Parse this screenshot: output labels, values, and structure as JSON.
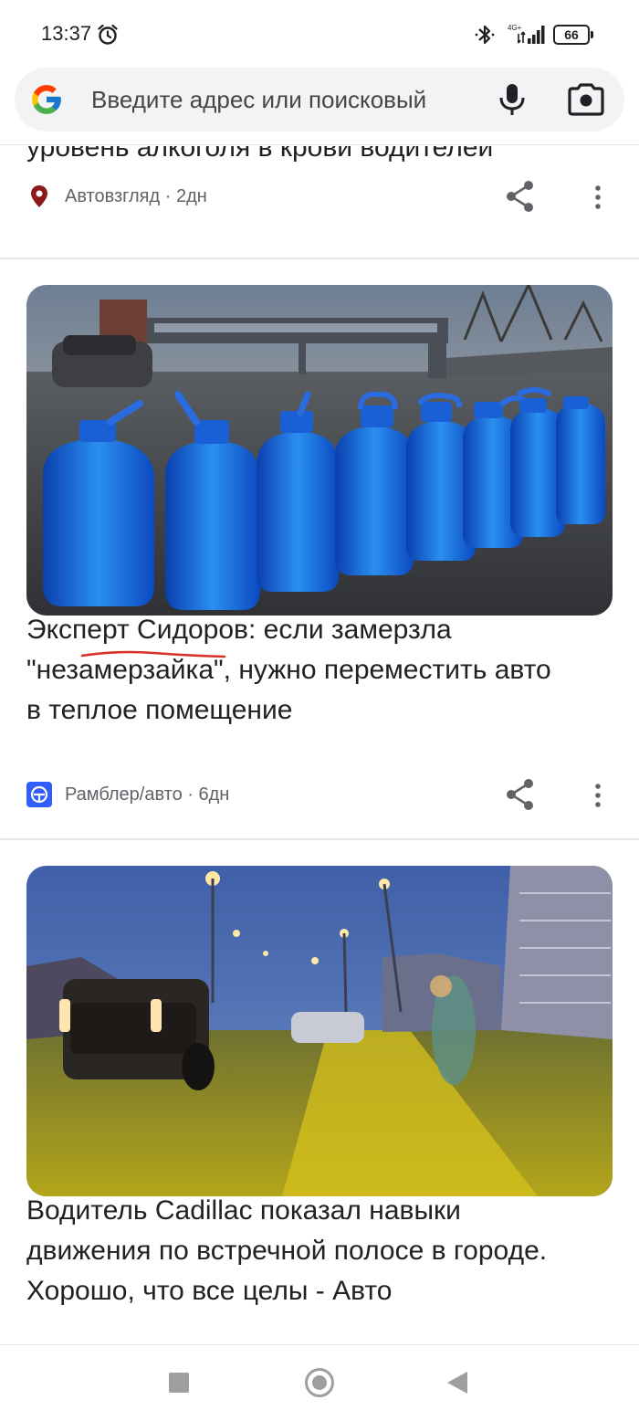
{
  "status_bar": {
    "time": "13:37",
    "network": "4G+",
    "battery": "66",
    "icons": [
      "alarm-icon",
      "bluetooth-icon",
      "signal-icon",
      "battery-icon"
    ]
  },
  "search": {
    "placeholder": "Введите адрес или поисковый",
    "icons": [
      "google-logo",
      "mic-icon",
      "lens-camera-icon"
    ]
  },
  "feed": {
    "cards": [
      {
        "title_lines": [
          "уровень алкоголя в крови водителей"
        ],
        "source": "Автовзгляд · 2дн",
        "source_icon": "location-pin-icon",
        "source_color": "#8b1a1a"
      },
      {
        "image_alt": "bottles-of-washer-fluid-photo",
        "title_lines": [
          "Эксперт Сидоров: если замерзла",
          "\"незамерзайка\", нужно переместить авто",
          "в теплое помещение"
        ],
        "source": "Рамблер/авто · 6дн",
        "source_icon": "rambler-auto-icon",
        "source_color": "#315efb",
        "annotation_color": "#d93025"
      },
      {
        "image_alt": "dashcam-street-photo",
        "title_lines": [
          "Водитель Cadillac показал навыки",
          "движения по встречной полосе в городе.",
          "Хорошо, что все целы - Авто"
        ]
      }
    ]
  },
  "nav_bar": {
    "icons": [
      "recents-square-icon",
      "home-circle-icon",
      "back-triangle-icon"
    ]
  }
}
